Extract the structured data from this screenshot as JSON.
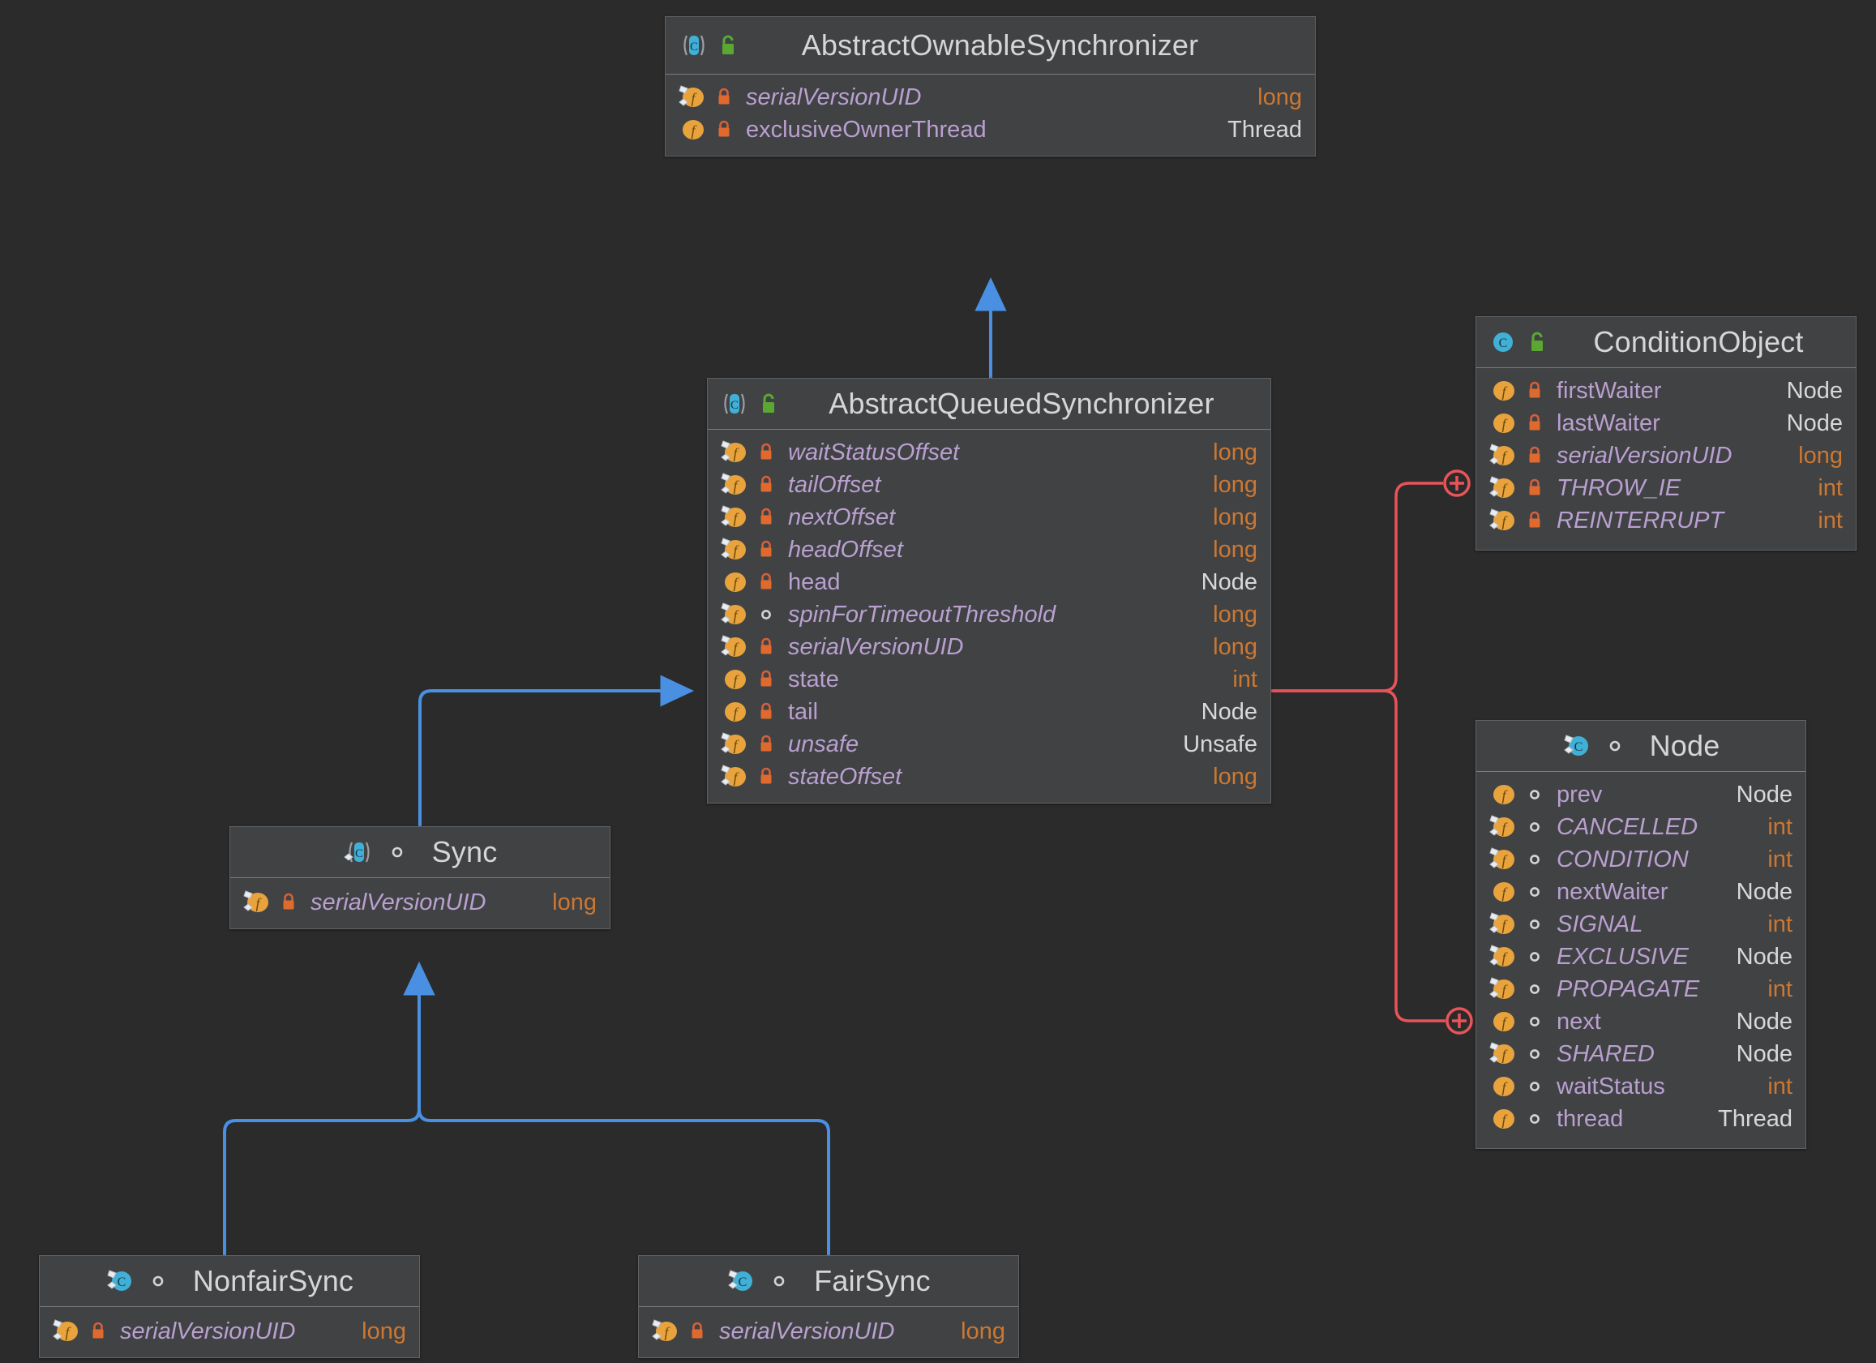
{
  "diagram": {
    "kind": "uml-class-diagram",
    "background_color": "#2b2b2b",
    "class_fill": "#414244",
    "class_border": "#606366",
    "inheritance_color": "#4a90e2",
    "inner_class_color": "#e8545a",
    "field_name_color": "#b9a0d0",
    "primitive_type_color": "#cc7832",
    "reference_type_color": "#d8d8d8"
  },
  "classes": {
    "abstract_ownable_synchronizer": {
      "name": "AbstractOwnableSynchronizer",
      "kind_icon": "abstract-class-icon",
      "visibility_icon": "public-unlocked-icon",
      "fields": [
        {
          "name": "serialVersionUID",
          "type": "long",
          "type_kind": "primitive",
          "static": true,
          "italic": true,
          "visibility_icon": "private-lock-icon"
        },
        {
          "name": "exclusiveOwnerThread",
          "type": "Thread",
          "type_kind": "reference",
          "static": false,
          "italic": false,
          "visibility_icon": "private-lock-icon"
        }
      ]
    },
    "abstract_queued_synchronizer": {
      "name": "AbstractQueuedSynchronizer",
      "kind_icon": "abstract-class-icon",
      "visibility_icon": "public-unlocked-icon",
      "fields": [
        {
          "name": "waitStatusOffset",
          "type": "long",
          "type_kind": "primitive",
          "static": true,
          "italic": true,
          "visibility_icon": "private-lock-icon"
        },
        {
          "name": "tailOffset",
          "type": "long",
          "type_kind": "primitive",
          "static": true,
          "italic": true,
          "visibility_icon": "private-lock-icon"
        },
        {
          "name": "nextOffset",
          "type": "long",
          "type_kind": "primitive",
          "static": true,
          "italic": true,
          "visibility_icon": "private-lock-icon"
        },
        {
          "name": "headOffset",
          "type": "long",
          "type_kind": "primitive",
          "static": true,
          "italic": true,
          "visibility_icon": "private-lock-icon"
        },
        {
          "name": "head",
          "type": "Node",
          "type_kind": "reference",
          "static": false,
          "italic": false,
          "visibility_icon": "private-lock-icon"
        },
        {
          "name": "spinForTimeoutThreshold",
          "type": "long",
          "type_kind": "primitive",
          "static": true,
          "italic": true,
          "visibility_icon": "package-private-icon"
        },
        {
          "name": "serialVersionUID",
          "type": "long",
          "type_kind": "primitive",
          "static": true,
          "italic": true,
          "visibility_icon": "private-lock-icon"
        },
        {
          "name": "state",
          "type": "int",
          "type_kind": "primitive",
          "static": false,
          "italic": false,
          "visibility_icon": "private-lock-icon"
        },
        {
          "name": "tail",
          "type": "Node",
          "type_kind": "reference",
          "static": false,
          "italic": false,
          "visibility_icon": "private-lock-icon"
        },
        {
          "name": "unsafe",
          "type": "Unsafe",
          "type_kind": "reference",
          "static": true,
          "italic": true,
          "visibility_icon": "private-lock-icon"
        },
        {
          "name": "stateOffset",
          "type": "long",
          "type_kind": "primitive",
          "static": true,
          "italic": true,
          "visibility_icon": "private-lock-icon"
        }
      ]
    },
    "condition_object": {
      "name": "ConditionObject",
      "kind_icon": "class-icon",
      "visibility_icon": "public-unlocked-icon",
      "fields": [
        {
          "name": "firstWaiter",
          "type": "Node",
          "type_kind": "reference",
          "static": false,
          "italic": false,
          "visibility_icon": "private-lock-icon"
        },
        {
          "name": "lastWaiter",
          "type": "Node",
          "type_kind": "reference",
          "static": false,
          "italic": false,
          "visibility_icon": "private-lock-icon"
        },
        {
          "name": "serialVersionUID",
          "type": "long",
          "type_kind": "primitive",
          "static": true,
          "italic": true,
          "visibility_icon": "private-lock-icon"
        },
        {
          "name": "THROW_IE",
          "type": "int",
          "type_kind": "primitive",
          "static": true,
          "italic": true,
          "visibility_icon": "private-lock-icon"
        },
        {
          "name": "REINTERRUPT",
          "type": "int",
          "type_kind": "primitive",
          "static": true,
          "italic": true,
          "visibility_icon": "private-lock-icon"
        }
      ]
    },
    "node": {
      "name": "Node",
      "kind_icon": "static-class-icon",
      "visibility_icon": "package-private-icon",
      "fields": [
        {
          "name": "prev",
          "type": "Node",
          "type_kind": "reference",
          "static": false,
          "italic": false,
          "visibility_icon": "package-private-icon"
        },
        {
          "name": "CANCELLED",
          "type": "int",
          "type_kind": "primitive",
          "static": true,
          "italic": true,
          "visibility_icon": "package-private-icon"
        },
        {
          "name": "CONDITION",
          "type": "int",
          "type_kind": "primitive",
          "static": true,
          "italic": true,
          "visibility_icon": "package-private-icon"
        },
        {
          "name": "nextWaiter",
          "type": "Node",
          "type_kind": "reference",
          "static": false,
          "italic": false,
          "visibility_icon": "package-private-icon"
        },
        {
          "name": "SIGNAL",
          "type": "int",
          "type_kind": "primitive",
          "static": true,
          "italic": true,
          "visibility_icon": "package-private-icon"
        },
        {
          "name": "EXCLUSIVE",
          "type": "Node",
          "type_kind": "reference",
          "static": true,
          "italic": true,
          "visibility_icon": "package-private-icon"
        },
        {
          "name": "PROPAGATE",
          "type": "int",
          "type_kind": "primitive",
          "static": true,
          "italic": true,
          "visibility_icon": "package-private-icon"
        },
        {
          "name": "next",
          "type": "Node",
          "type_kind": "reference",
          "static": false,
          "italic": false,
          "visibility_icon": "package-private-icon"
        },
        {
          "name": "SHARED",
          "type": "Node",
          "type_kind": "reference",
          "static": true,
          "italic": true,
          "visibility_icon": "package-private-icon"
        },
        {
          "name": "waitStatus",
          "type": "int",
          "type_kind": "primitive",
          "static": false,
          "italic": false,
          "visibility_icon": "package-private-icon"
        },
        {
          "name": "thread",
          "type": "Thread",
          "type_kind": "reference",
          "static": false,
          "italic": false,
          "visibility_icon": "package-private-icon"
        }
      ]
    },
    "sync": {
      "name": "Sync",
      "kind_icon": "abstract-static-class-icon",
      "visibility_icon": "package-private-icon",
      "fields": [
        {
          "name": "serialVersionUID",
          "type": "long",
          "type_kind": "primitive",
          "static": true,
          "italic": true,
          "visibility_icon": "private-lock-icon"
        }
      ]
    },
    "nonfair_sync": {
      "name": "NonfairSync",
      "kind_icon": "static-class-icon",
      "visibility_icon": "package-private-icon",
      "fields": [
        {
          "name": "serialVersionUID",
          "type": "long",
          "type_kind": "primitive",
          "static": true,
          "italic": true,
          "visibility_icon": "private-lock-icon"
        }
      ]
    },
    "fair_sync": {
      "name": "FairSync",
      "kind_icon": "static-class-icon",
      "visibility_icon": "package-private-icon",
      "fields": [
        {
          "name": "serialVersionUID",
          "type": "long",
          "type_kind": "primitive",
          "static": true,
          "italic": true,
          "visibility_icon": "private-lock-icon"
        }
      ]
    }
  },
  "relations": [
    {
      "type": "inheritance",
      "from": "abstract_queued_synchronizer",
      "to": "abstract_ownable_synchronizer"
    },
    {
      "type": "inheritance",
      "from": "sync",
      "to": "abstract_queued_synchronizer"
    },
    {
      "type": "inheritance",
      "from": "nonfair_sync",
      "to": "sync"
    },
    {
      "type": "inheritance",
      "from": "fair_sync",
      "to": "sync"
    },
    {
      "type": "inner-class",
      "from": "abstract_queued_synchronizer",
      "to": "condition_object"
    },
    {
      "type": "inner-class",
      "from": "abstract_queued_synchronizer",
      "to": "node"
    }
  ]
}
